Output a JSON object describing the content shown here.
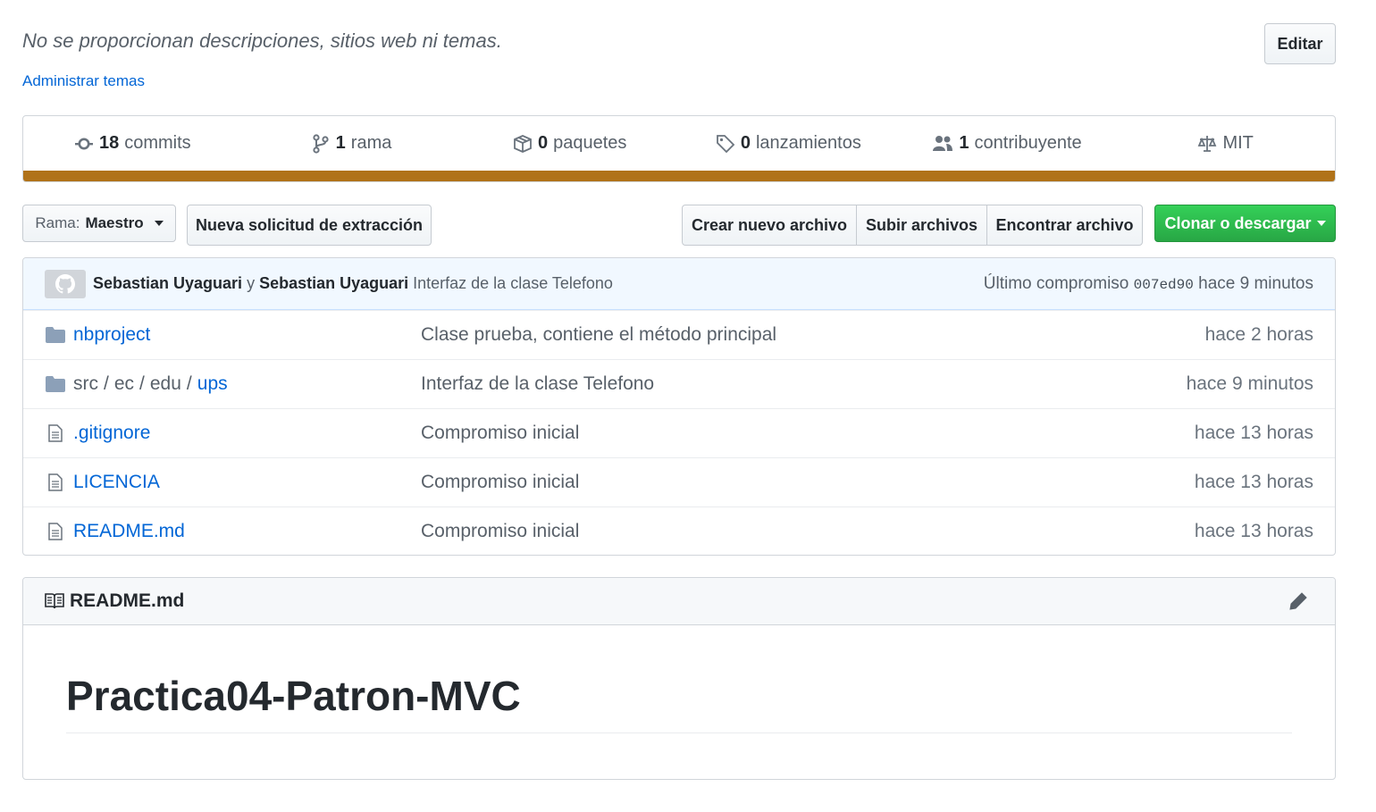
{
  "repo_meta": {
    "description": "No se proporcionan descripciones, sitios web ni temas.",
    "manage_topics": "Administrar temas",
    "edit_label": "Editar"
  },
  "summary": {
    "commits": {
      "count": "18",
      "label": "commits",
      "icon": "commit-icon"
    },
    "branches": {
      "count": "1",
      "label": "rama",
      "icon": "branch-icon"
    },
    "packages": {
      "count": "0",
      "label": "paquetes",
      "icon": "package-icon"
    },
    "releases": {
      "count": "0",
      "label": "lanzamientos",
      "icon": "tag-icon"
    },
    "contributors": {
      "count": "1",
      "label": "contribuyente",
      "icon": "people-icon"
    },
    "license": {
      "label": "MIT",
      "icon": "law-icon"
    },
    "language_bar_color": "#b07219"
  },
  "actions": {
    "branch_label": "Rama:",
    "branch_value": "Maestro",
    "new_pull_request": "Nueva solicitud de extracción",
    "create_file": "Crear nuevo archivo",
    "upload_files": "Subir archivos",
    "find_file": "Encontrar archivo",
    "clone_download": "Clonar o descargar",
    "clone_color": "#28a745"
  },
  "latest_commit": {
    "author": "Sebastian Uyaguari",
    "joiner": "y",
    "committer": "Sebastian Uyaguari",
    "message": "Interfaz de la clase Telefono",
    "label": "Último compromiso",
    "sha": "007ed90",
    "age": "hace 9 minutos"
  },
  "files": [
    {
      "type": "folder",
      "name": "nbproject",
      "message": "Clase prueba, contiene el método principal",
      "age": "hace 2 horas"
    },
    {
      "type": "folder",
      "path": [
        "src",
        "ec",
        "edu"
      ],
      "sep": "/",
      "name": "ups",
      "message": "Interfaz de la clase Telefono",
      "age": "hace 9 minutos"
    },
    {
      "type": "file",
      "name": ".gitignore",
      "message": "Compromiso inicial",
      "age": "hace 13 horas"
    },
    {
      "type": "file",
      "name": "LICENCIA",
      "message": "Compromiso inicial",
      "age": "hace 13 horas"
    },
    {
      "type": "file",
      "name": "README.md",
      "message": "Compromiso inicial",
      "age": "hace 13 horas"
    }
  ],
  "readme": {
    "filename": "README.md",
    "title": "Practica04-Patron-MVC"
  }
}
